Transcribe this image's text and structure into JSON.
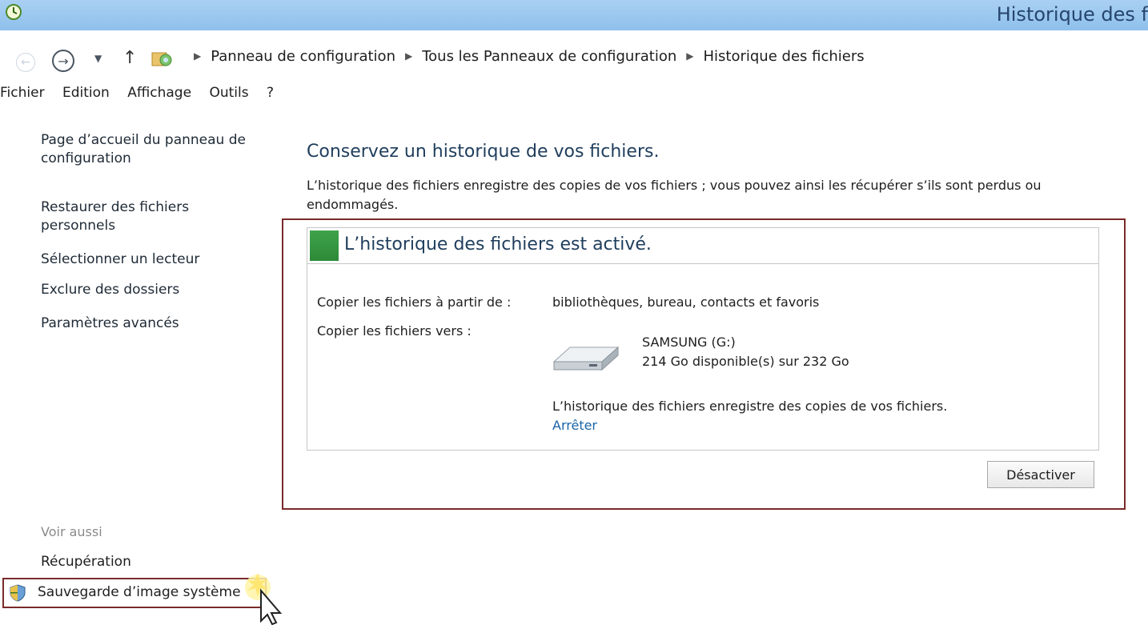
{
  "window": {
    "title": "Historique des f"
  },
  "address": {
    "crumbs": [
      "Panneau de configuration",
      "Tous les Panneaux de configuration",
      "Historique des fichiers"
    ]
  },
  "menu": [
    "Fichier",
    "Edition",
    "Affichage",
    "Outils",
    "?"
  ],
  "sidebar": {
    "links": [
      "Page d’accueil du panneau de configuration",
      "Restaurer des fichiers personnels",
      "Sélectionner un lecteur",
      "Exclure des dossiers",
      "Paramètres avancés"
    ],
    "see_also_heading": "Voir aussi",
    "see_also": [
      "Récupération",
      "Sauvegarde d’image système"
    ]
  },
  "main": {
    "title": "Conservez un historique de vos fichiers.",
    "description": "L’historique des fichiers enregistre des copies de vos fichiers ; vous pouvez ainsi les récupérer s’ils sont perdus ou endommagés.",
    "status": "L’historique des fichiers est activé.",
    "status_color": "#3a9b45",
    "copy_from_label": "Copier les fichiers à partir de :",
    "copy_from_value": "bibliothèques, bureau, contacts et favoris",
    "copy_to_label": "Copier les fichiers vers :",
    "drive_name": "SAMSUNG (G:)",
    "drive_space": "214 Go disponible(s) sur 232 Go",
    "saving_msg": "L’historique des fichiers enregistre des copies de vos fichiers.",
    "stop_link": "Arrêter",
    "disable_button": "Désactiver"
  },
  "highlight_color": "#7a2a2a"
}
